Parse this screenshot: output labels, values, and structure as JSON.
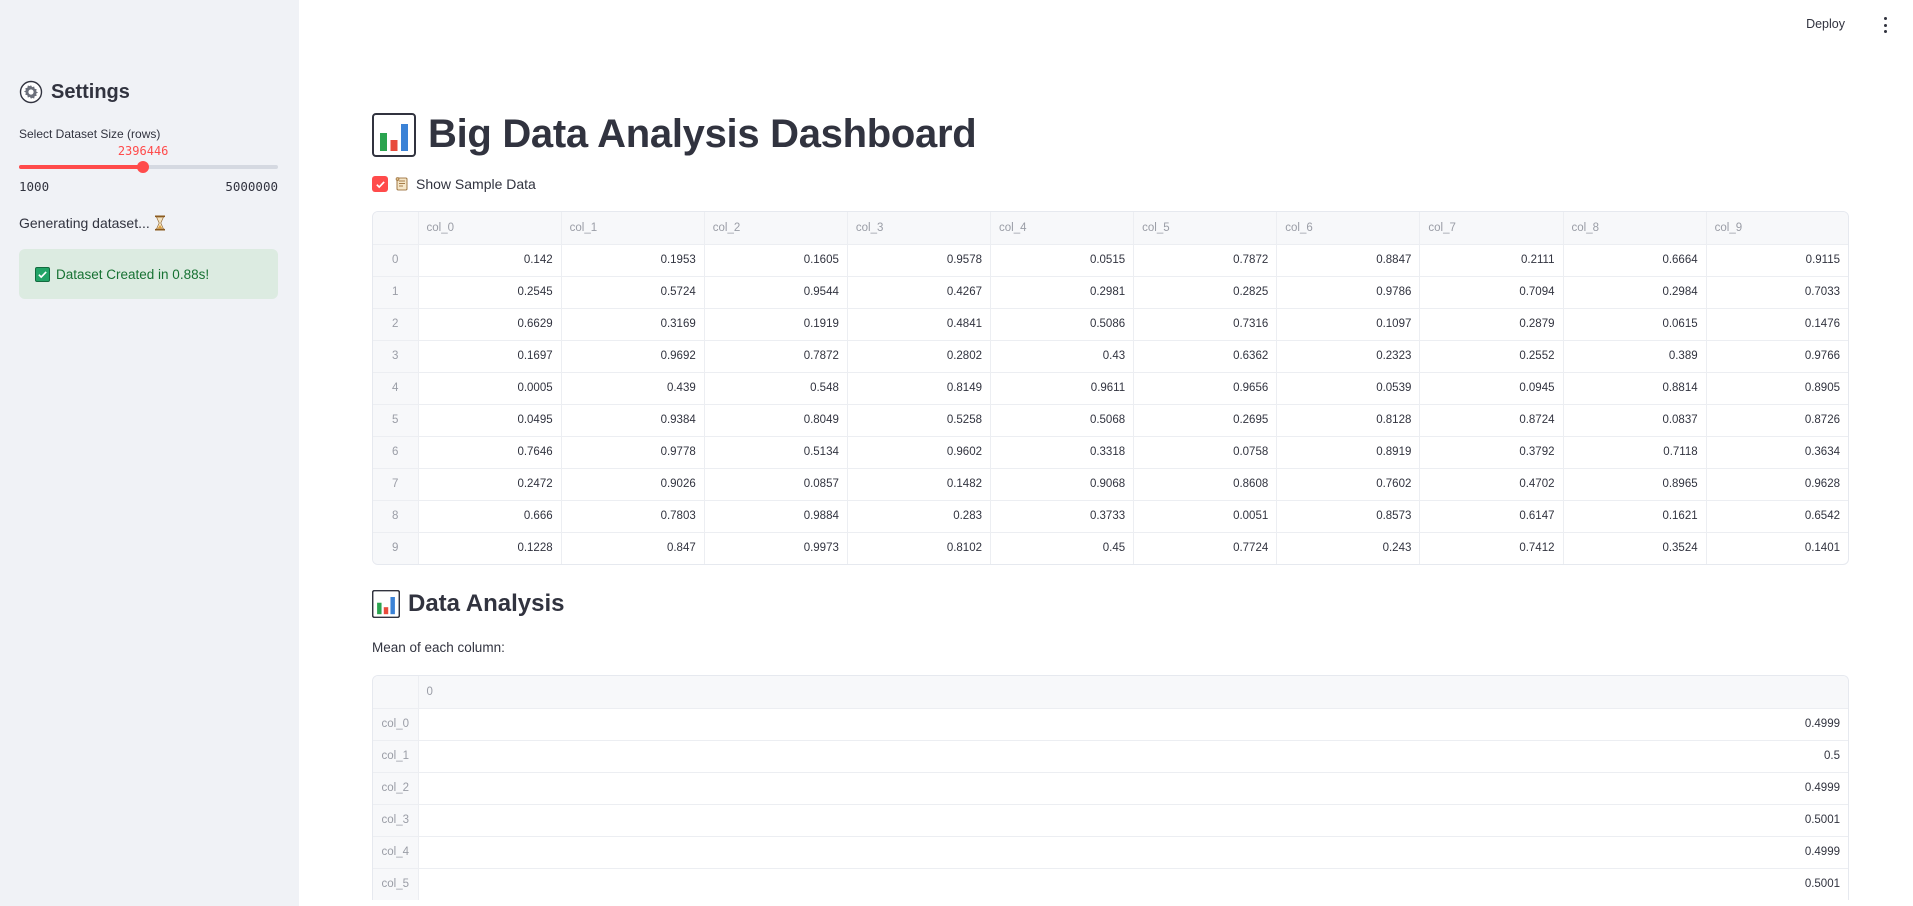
{
  "header": {
    "deploy_label": "Deploy",
    "menu_icon": "kebab-menu-icon"
  },
  "sidebar": {
    "title": "Settings",
    "title_icon": "gear-icon",
    "slider": {
      "label": "Select Dataset Size (rows)",
      "value": "2396446",
      "min": "1000",
      "max": "5000000",
      "fraction": 0.4792
    },
    "status_text": "Generating dataset...",
    "success_message": "Dataset Created in 0.88s!",
    "accent_color": "#ff4b4b"
  },
  "main": {
    "title": "Big Data Analysis Dashboard",
    "title_icon": "bar-chart-icon",
    "show_sample": {
      "label": "Show Sample Data",
      "checked": true,
      "icon": "scroll-icon"
    },
    "sample_table": {
      "columns": [
        "col_0",
        "col_1",
        "col_2",
        "col_3",
        "col_4",
        "col_5",
        "col_6",
        "col_7",
        "col_8",
        "col_9"
      ],
      "rows": [
        {
          "index": "0",
          "values": [
            "0.142",
            "0.1953",
            "0.1605",
            "0.9578",
            "0.0515",
            "0.7872",
            "0.8847",
            "0.2111",
            "0.6664",
            "0.9115"
          ]
        },
        {
          "index": "1",
          "values": [
            "0.2545",
            "0.5724",
            "0.9544",
            "0.4267",
            "0.2981",
            "0.2825",
            "0.9786",
            "0.7094",
            "0.2984",
            "0.7033"
          ]
        },
        {
          "index": "2",
          "values": [
            "0.6629",
            "0.3169",
            "0.1919",
            "0.4841",
            "0.5086",
            "0.7316",
            "0.1097",
            "0.2879",
            "0.0615",
            "0.1476"
          ]
        },
        {
          "index": "3",
          "values": [
            "0.1697",
            "0.9692",
            "0.7872",
            "0.2802",
            "0.43",
            "0.6362",
            "0.2323",
            "0.2552",
            "0.389",
            "0.9766"
          ]
        },
        {
          "index": "4",
          "values": [
            "0.0005",
            "0.439",
            "0.548",
            "0.8149",
            "0.9611",
            "0.9656",
            "0.0539",
            "0.0945",
            "0.8814",
            "0.8905"
          ]
        },
        {
          "index": "5",
          "values": [
            "0.0495",
            "0.9384",
            "0.8049",
            "0.5258",
            "0.5068",
            "0.2695",
            "0.8128",
            "0.8724",
            "0.0837",
            "0.8726"
          ]
        },
        {
          "index": "6",
          "values": [
            "0.7646",
            "0.9778",
            "0.5134",
            "0.9602",
            "0.3318",
            "0.0758",
            "0.8919",
            "0.3792",
            "0.7118",
            "0.3634"
          ]
        },
        {
          "index": "7",
          "values": [
            "0.2472",
            "0.9026",
            "0.0857",
            "0.1482",
            "0.9068",
            "0.8608",
            "0.7602",
            "0.4702",
            "0.8965",
            "0.9628"
          ]
        },
        {
          "index": "8",
          "values": [
            "0.666",
            "0.7803",
            "0.9884",
            "0.283",
            "0.3733",
            "0.0051",
            "0.8573",
            "0.6147",
            "0.1621",
            "0.6542"
          ]
        },
        {
          "index": "9",
          "values": [
            "0.1228",
            "0.847",
            "0.9973",
            "0.8102",
            "0.45",
            "0.7724",
            "0.243",
            "0.7412",
            "0.3524",
            "0.1401"
          ]
        }
      ]
    },
    "analysis": {
      "title": "Data Analysis",
      "mean_label": "Mean of each column:",
      "mean_table": {
        "header": "0",
        "rows": [
          {
            "index": "col_0",
            "value": "0.4999"
          },
          {
            "index": "col_1",
            "value": "0.5"
          },
          {
            "index": "col_2",
            "value": "0.4999"
          },
          {
            "index": "col_3",
            "value": "0.5001"
          },
          {
            "index": "col_4",
            "value": "0.4999"
          },
          {
            "index": "col_5",
            "value": "0.5001"
          }
        ]
      }
    }
  }
}
